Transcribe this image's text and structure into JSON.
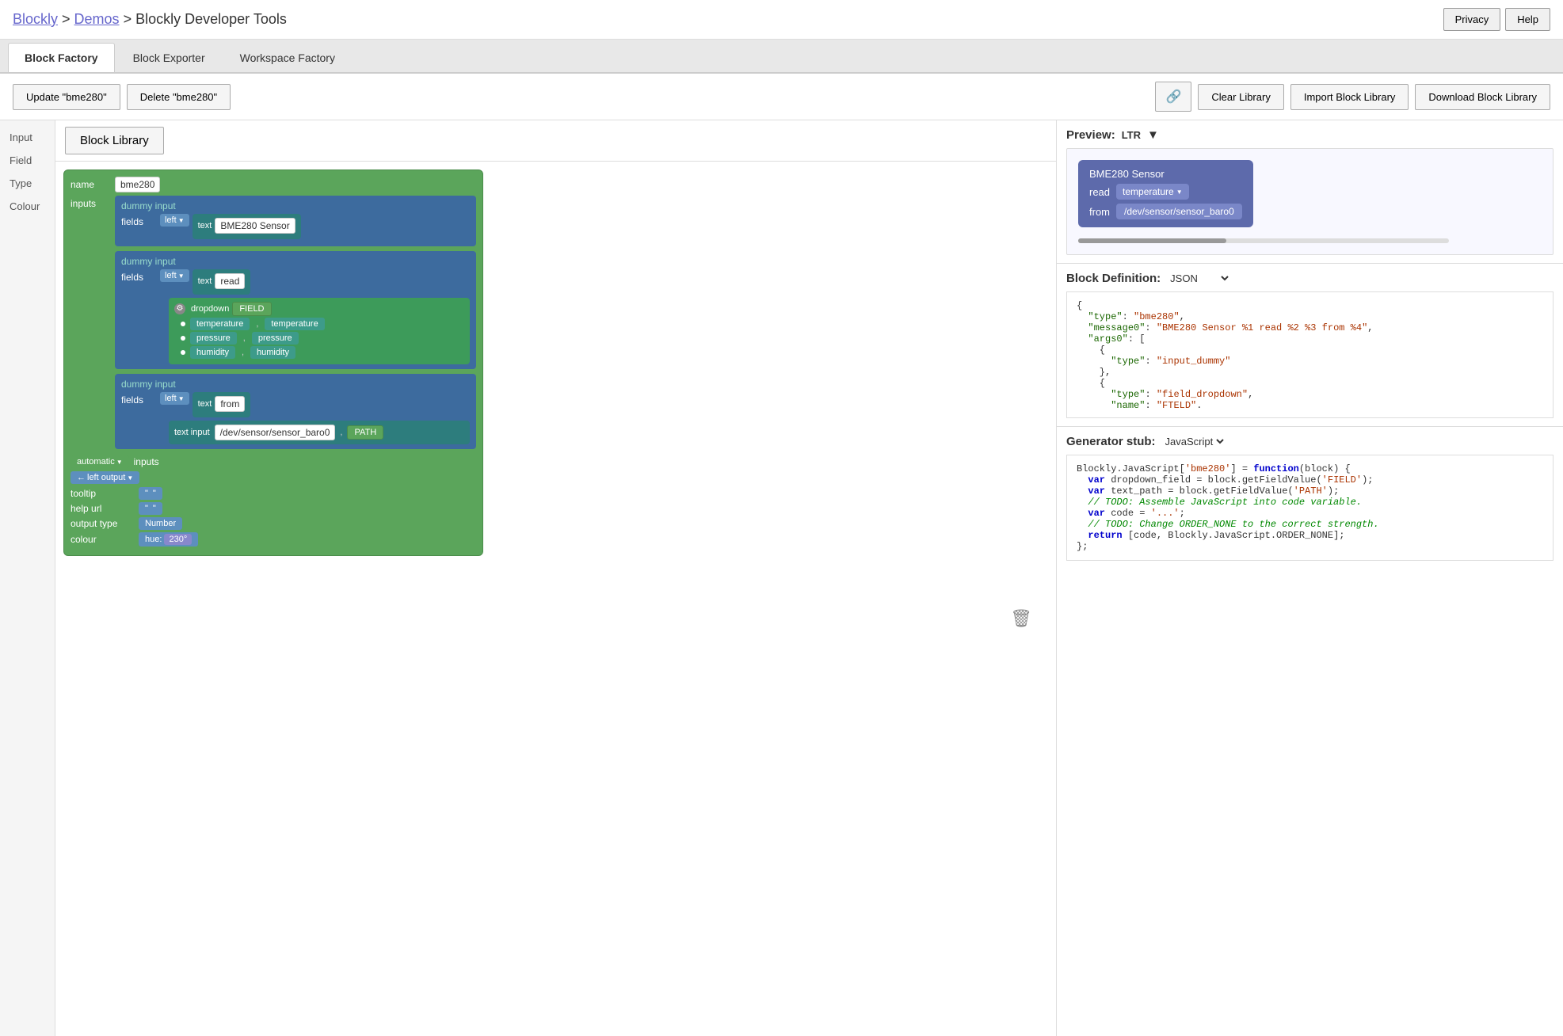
{
  "header": {
    "title_parts": [
      "Blockly",
      " > ",
      "Demos",
      " > Blockly Developer Tools"
    ],
    "privacy_label": "Privacy",
    "help_label": "Help"
  },
  "tabs": [
    {
      "label": "Block Factory",
      "active": true
    },
    {
      "label": "Block Exporter",
      "active": false
    },
    {
      "label": "Workspace Factory",
      "active": false
    }
  ],
  "toolbar": {
    "update_label": "Update \"bme280\"",
    "delete_label": "Delete \"bme280\"",
    "clear_label": "Clear Library",
    "import_label": "Import Block Library",
    "download_label": "Download Block Library"
  },
  "sidebar": {
    "items": [
      "Input",
      "Field",
      "Type",
      "Colour"
    ]
  },
  "block_library": {
    "button_label": "Block Library"
  },
  "block_editor": {
    "name_label": "name",
    "name_value": "bme280",
    "inputs_label": "inputs",
    "dummy_input_label": "dummy input",
    "fields_label": "fields",
    "left_label": "left",
    "text_bme280_sensor": "BME280 Sensor",
    "text_read": "read",
    "text_from": "from",
    "dropdown_label": "dropdown",
    "field_name": "FIELD",
    "options": [
      {
        "key": "temperature",
        "val": "temperature"
      },
      {
        "key": "pressure",
        "val": "pressure"
      },
      {
        "key": "humidity",
        "val": "humidity"
      }
    ],
    "text_input_label": "text input",
    "path_value": "/dev/sensor/sensor_baro0",
    "path_name": "PATH",
    "automatic_label": "automatic",
    "left_output_label": "left output",
    "tooltip_label": "tooltip",
    "help_url_label": "help url",
    "output_type_label": "output type",
    "output_type_value": "Number",
    "colour_label": "colour",
    "hue_label": "hue:",
    "hue_value": "230°"
  },
  "preview": {
    "header": "Preview:",
    "ltr_label": "LTR",
    "block_title": "BME280 Sensor",
    "read_label": "read",
    "temperature_label": "temperature",
    "from_label": "from",
    "path_label": "/dev/sensor/sensor_baro0"
  },
  "block_definition": {
    "header": "Block Definition:",
    "format_label": "JSON",
    "lines": [
      "{",
      "  \"type\": \"bme280\",",
      "  \"message0\": \"BME280 Sensor %1 read %2 %3 from %4\",",
      "  \"args0\": [",
      "    {",
      "      \"type\": \"input_dummy\"",
      "    },",
      "    {",
      "      \"type\": \"field_dropdown\",",
      "      \"name\": \"FTELD\"."
    ]
  },
  "generator_stub": {
    "header": "Generator stub:",
    "format_label": "JavaScript",
    "lines": [
      "Blockly.JavaScript['bme280'] = function(block) {",
      "  var dropdown_field = block.getFieldValue('FIELD');",
      "  var text_path = block.getFieldValue('PATH');",
      "  // TODO: Assemble JavaScript into code variable.",
      "  var code = '...';",
      "  // TODO: Change ORDER_NONE to the correct strength.",
      "  return [code, Blockly.JavaScript.ORDER_NONE];",
      "};"
    ]
  }
}
